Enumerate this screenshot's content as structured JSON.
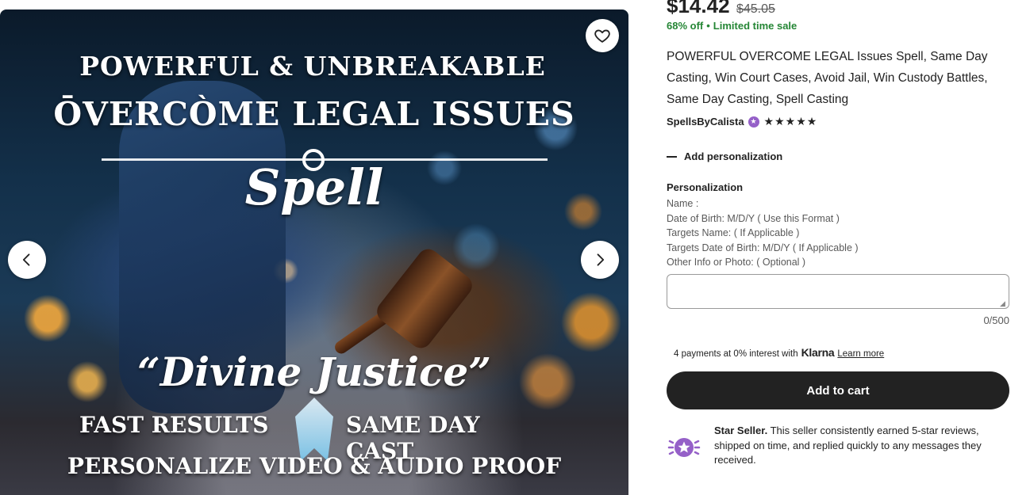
{
  "gallery": {
    "image_text": {
      "line1": "POWERFUL & UNBREAKABLE",
      "line2": "ŌVERCÒME LEGAL ISSUES",
      "line3": "Spell",
      "line4": "“Divine Justice”",
      "line5a": "FAST RESULTS",
      "line5b": "SAME DAY CAST",
      "line6": "PERSONALIZE VIDEO & AUDIO PROOF"
    },
    "favorite_icon": "heart-icon",
    "prev_icon": "chevron-left-icon",
    "next_icon": "chevron-right-icon"
  },
  "product": {
    "price": "$14.42",
    "original_price": "$45.05",
    "discount": "68% off",
    "sale_label": "Limited time sale",
    "title": "POWERFUL OVERCOME LEGAL Issues Spell, Same Day Casting, Win Court Cases, Avoid Jail, Win Custody Battles, Same Day Casting, Spell Casting",
    "seller": "SpellsByCalista",
    "stars": "★★★★★"
  },
  "personalization": {
    "toggle_label": "Add personalization",
    "title": "Personalization",
    "lines": [
      "Name :",
      "Date of Birth: M/D/Y ( Use this Format )",
      "Targets Name: ( If Applicable )",
      "Targets Date of Birth: M/D/Y ( If Applicable )",
      "Other Info or Photo: ( Optional )"
    ],
    "value": "",
    "char_count": "0/500"
  },
  "klarna": {
    "text": "4 payments at 0% interest with",
    "logo": "Klarna",
    "link": "Learn more"
  },
  "cart": {
    "label": "Add to cart"
  },
  "star_seller": {
    "bold": "Star Seller.",
    "text": " This seller consistently earned 5-star reviews, shipped on time, and replied quickly to any messages they received."
  },
  "colors": {
    "sale_green": "#258635",
    "cart_bg": "#222222",
    "star_seller_purple": "#9560c8"
  }
}
